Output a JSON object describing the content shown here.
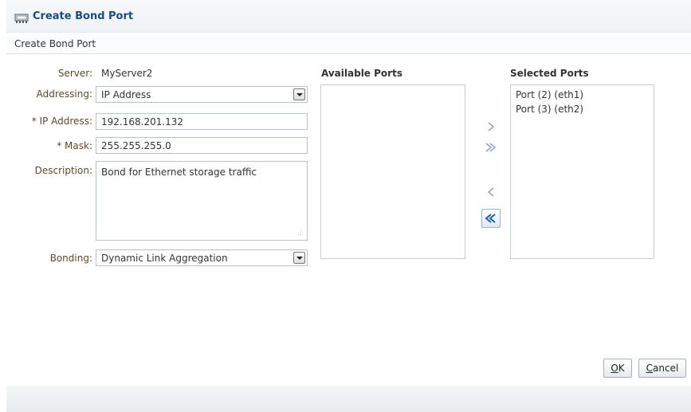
{
  "dialog": {
    "title": "Create Bond Port",
    "subheader": "Create Bond Port"
  },
  "form": {
    "server_label": "Server:",
    "server_value": "MyServer2",
    "addressing_label": "Addressing:",
    "addressing_value": "IP Address",
    "ip_label": "* IP Address:",
    "ip_value": "192.168.201.132",
    "mask_label": "* Mask:",
    "mask_value": "255.255.255.0",
    "description_label": "Description:",
    "description_value": "Bond for Ethernet storage traffic",
    "bonding_label": "Bonding:",
    "bonding_value": "Dynamic Link Aggregation"
  },
  "available_ports": {
    "header": "Available Ports",
    "items": []
  },
  "selected_ports": {
    "header": "Selected Ports",
    "items": [
      {
        "label": "Port (2) (eth1)"
      },
      {
        "label": "Port (3) (eth2)"
      }
    ]
  },
  "buttons": {
    "ok_mnemonic": "O",
    "ok_rest": "K",
    "cancel_mnemonic": "C",
    "cancel_rest": "ancel"
  },
  "colors": {
    "title": "#1a4b84",
    "label": "#5a4a2a",
    "shuttle_active": "#1f5fa8",
    "shuttle_disabled": "#9aa5b1"
  },
  "icons": {
    "title": "bond-port-icon",
    "move": "move-right-icon",
    "move_all": "move-all-right-icon",
    "remove": "move-left-icon",
    "remove_all": "move-all-left-icon"
  }
}
